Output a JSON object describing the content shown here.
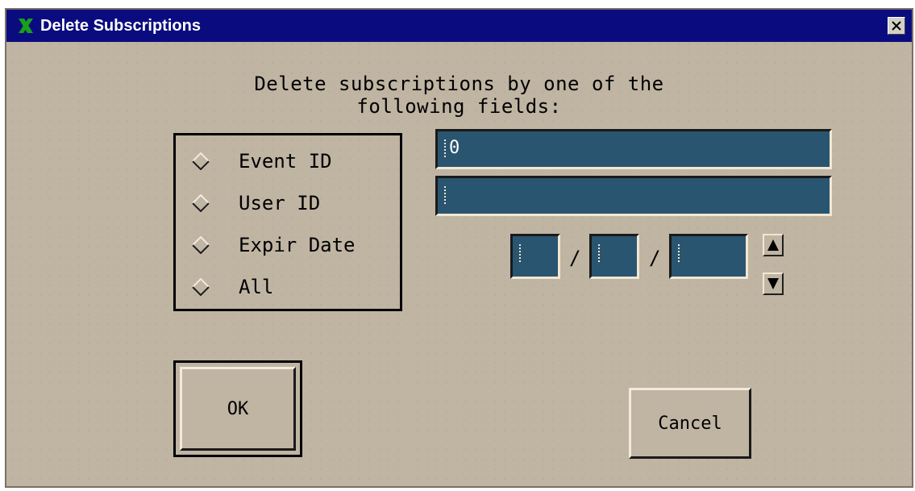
{
  "window": {
    "title": "Delete Subscriptions",
    "title_bar_color": "#0b0b80",
    "background_color": "#c0b4a3"
  },
  "dialog": {
    "heading_line1": "Delete subscriptions by one of the",
    "heading_line2": "following fields:",
    "options": [
      {
        "label": "Event ID",
        "icon": "radio-diamond-icon"
      },
      {
        "label": "User ID",
        "icon": "radio-diamond-icon"
      },
      {
        "label": "Expir Date",
        "icon": "radio-diamond-icon"
      },
      {
        "label": "All",
        "icon": "radio-diamond-icon"
      }
    ],
    "event_id_value": "0",
    "user_id_value": "",
    "date": {
      "separator": "/",
      "month": "",
      "day": "",
      "year": ""
    },
    "field_color": "#2a5570",
    "buttons": {
      "ok_label": "OK",
      "cancel_label": "Cancel"
    }
  }
}
